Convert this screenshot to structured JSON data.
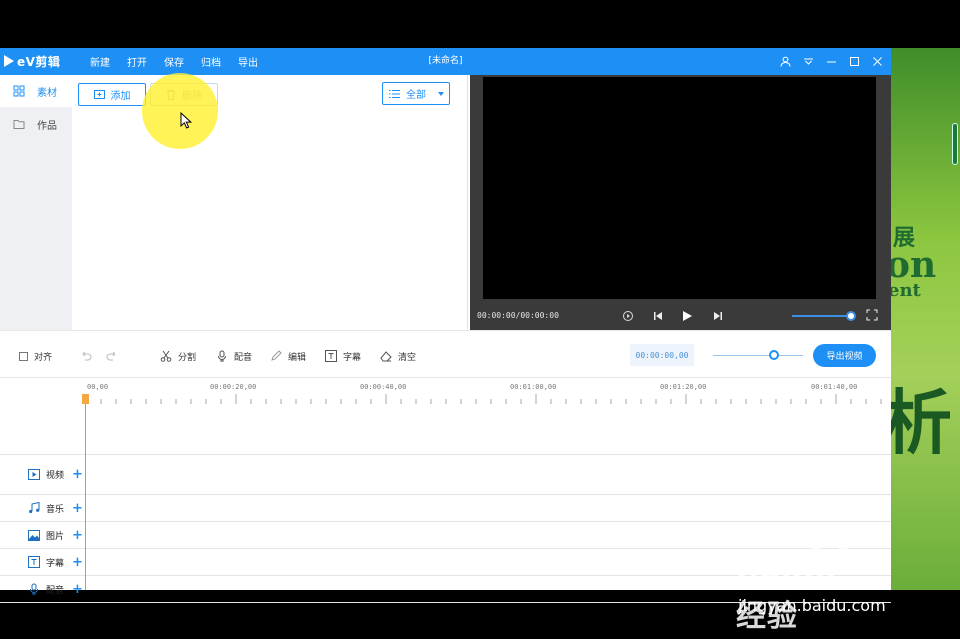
{
  "app": {
    "logo": "eV剪辑",
    "window_title": "[未命名]",
    "menu": [
      "新建",
      "打开",
      "保存",
      "归档",
      "导出"
    ]
  },
  "sidebar": {
    "items": [
      {
        "label": "素材",
        "icon": "grid-icon",
        "active": true
      },
      {
        "label": "作品",
        "icon": "folder-icon",
        "active": false
      }
    ]
  },
  "media": {
    "add_label": "添加",
    "delete_label": "删除",
    "filter_label": "全部"
  },
  "preview": {
    "time": "00:00:00/00:00:00"
  },
  "toolbar": {
    "align_label": "对齐",
    "split_label": "分割",
    "dub_label": "配音",
    "edit_label": "编辑",
    "subtitle_label": "字幕",
    "clear_label": "清空",
    "timecode": "00:00:00,00",
    "export_label": "导出视频"
  },
  "timeline": {
    "ruler_labels": [
      "00,00",
      "00:00:20,00",
      "00:00:40,00",
      "00:01:00,00",
      "00:01:20,00",
      "00:01:40,00"
    ],
    "tracks": [
      {
        "label": "视频",
        "icon": "video-icon"
      },
      {
        "label": "音乐",
        "icon": "music-icon"
      },
      {
        "label": "图片",
        "icon": "image-icon"
      },
      {
        "label": "字幕",
        "icon": "text-icon"
      },
      {
        "label": "配音",
        "icon": "mic-icon"
      }
    ]
  },
  "background": {
    "poster_text": [
      "展",
      "on",
      "ent",
      "析"
    ]
  },
  "watermark": {
    "brand": "Baidu经验",
    "url": "jingyan.baidu.com"
  },
  "colors": {
    "accent": "#1e90f5",
    "playhead": "#f08a3c",
    "highlight": "#fff028"
  }
}
